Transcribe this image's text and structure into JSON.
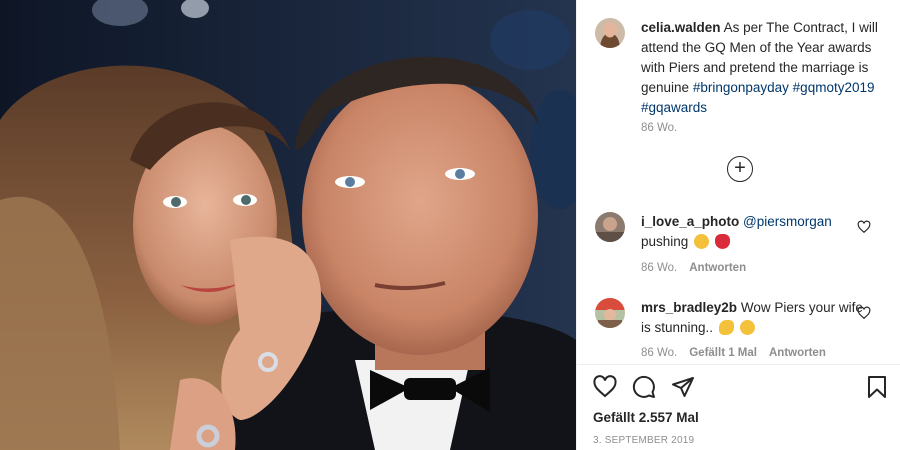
{
  "post": {
    "author": "celia.walden",
    "caption_text": "As per The Contract, I will attend the GQ Men of the Year awards with Piers and pretend the marriage is genuine",
    "hashtags": [
      "#bringonpayday",
      "#gqmoty2019",
      "#gqawards"
    ],
    "caption_time": "86 Wo.",
    "load_more_symbol": "+"
  },
  "comments": [
    {
      "username": "i_love_a_photo",
      "mention": "@piersmorgan",
      "text": "pushing",
      "emojis": [
        "laughing-emoji",
        "lips-emoji"
      ],
      "time": "86 Wo.",
      "likes": "",
      "reply_label": "Antworten"
    },
    {
      "username": "mrs_bradley2b",
      "mention": "",
      "text": "Wow Piers your wife is stunning..",
      "emojis": [
        "clapping-emoji",
        "smiling-emoji"
      ],
      "time": "86 Wo.",
      "likes": "Gefällt 1 Mal",
      "reply_label": "Antworten"
    }
  ],
  "footer": {
    "likes": "Gefällt 2.557 Mal",
    "date": "3. SEPTEMBER 2019"
  },
  "icons": {
    "like": "heart-icon",
    "comment": "comment-icon",
    "share": "share-icon",
    "save": "bookmark-icon",
    "comment_like": "heart-icon",
    "load_more": "plus-circle-icon"
  },
  "colors": {
    "text": "#262626",
    "secondary": "#8e8e8e",
    "hashtag": "#00376b",
    "divider": "#efefef"
  }
}
